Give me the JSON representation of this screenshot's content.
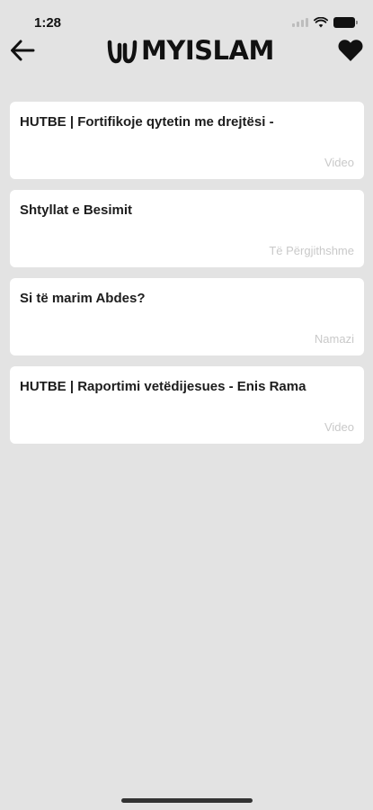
{
  "status_bar": {
    "time": "1:28"
  },
  "header": {
    "back_icon": "arrow-left-icon",
    "logo_text": "MYISLAM",
    "favorite_icon": "heart-icon"
  },
  "items": [
    {
      "title": "HUTBE | Fortifikoje qytetin me drejtësi -",
      "category": "Video"
    },
    {
      "title": "Shtyllat e Besimit",
      "category": "Të Përgjithshme"
    },
    {
      "title": "Si të marim Abdes?",
      "category": "Namazi"
    },
    {
      "title": "HUTBE | Raportimi vetëdijesues - Enis Rama",
      "category": "Video"
    }
  ],
  "colors": {
    "background": "#e3e3e3",
    "card": "#ffffff",
    "category_text": "#c9c9c9"
  }
}
